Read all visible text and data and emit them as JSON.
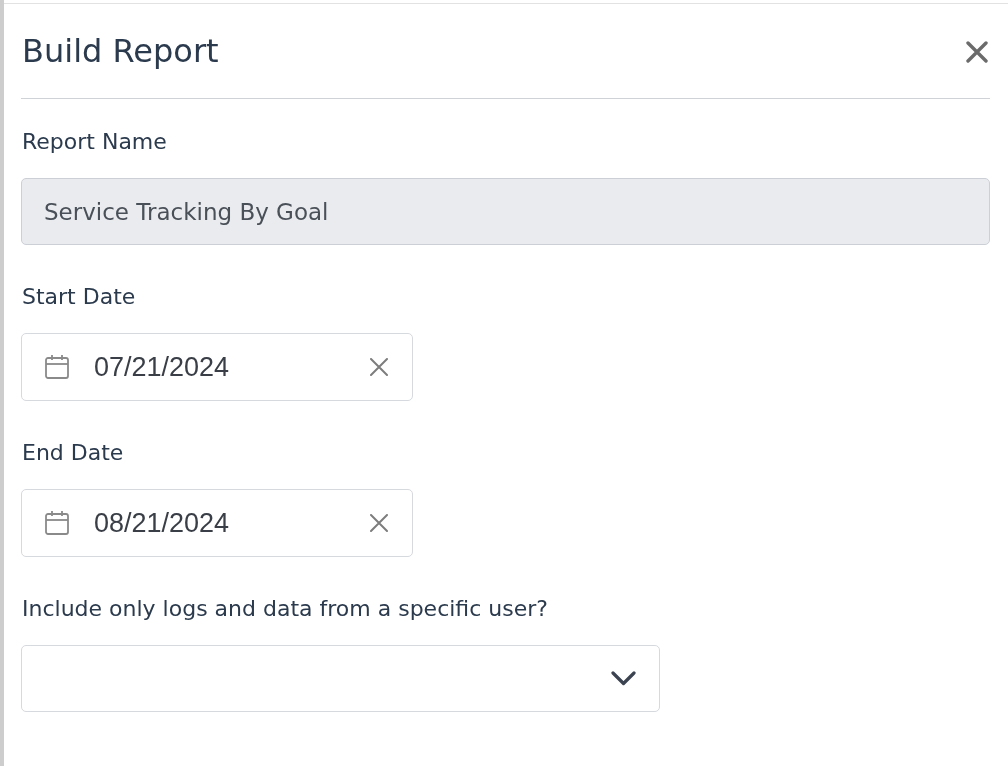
{
  "dialog": {
    "title": "Build Report",
    "fields": [
      {
        "kind": "text",
        "label": "Report Name",
        "value": "Service Tracking By Goal",
        "disabled": true
      },
      {
        "kind": "date",
        "label": "Start Date",
        "value": "07/21/2024"
      },
      {
        "kind": "date",
        "label": "End Date",
        "value": "08/21/2024"
      },
      {
        "kind": "select",
        "label": "Include only logs and data from a specific user?"
      }
    ]
  }
}
